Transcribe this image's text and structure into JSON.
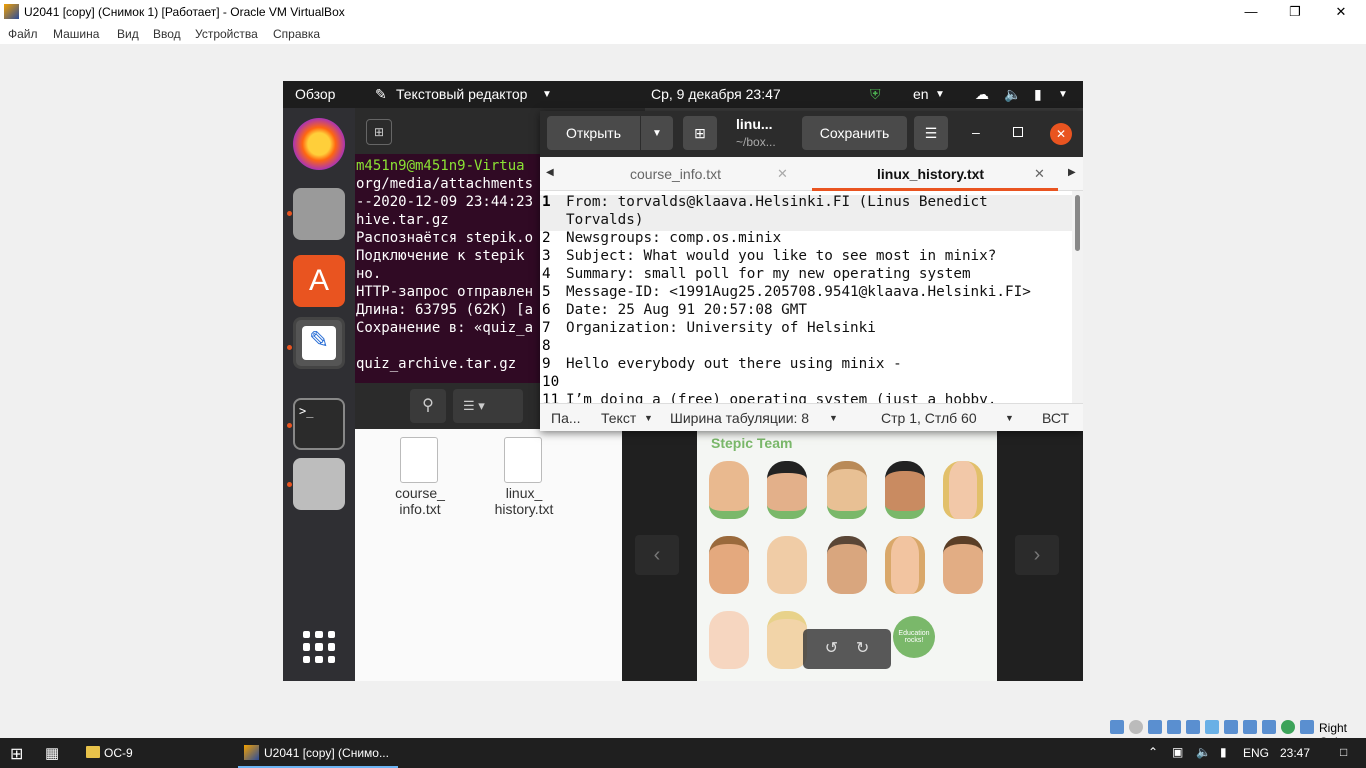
{
  "host": {
    "window_title": "U2041 [copy] (Снимок 1) [Работает] - Oracle VM VirtualBox",
    "menu": [
      "Файл",
      "Машина",
      "Вид",
      "Ввод",
      "Устройства",
      "Справка"
    ],
    "host_key": "Right Ctrl"
  },
  "guest_topbar": {
    "overview": "Обзор",
    "app_menu": "Текстовый редактор",
    "clock": "Ср, 9 декабря  23:47",
    "lang": "en"
  },
  "terminal": {
    "lines": [
      "m451n9@m451n9-Virtua",
      "org/media/attachments",
      "--2020-12-09 23:44:23",
      "hive.tar.gz",
      "Распознаётся stepik.o",
      "Подключение к stepik",
      "но.",
      "HTTP-запрос отправлен",
      "Длина: 63795 (62K) [a",
      "Сохранение в: «quiz_a",
      "",
      "quiz_archive.tar.gz  "
    ]
  },
  "files": {
    "items": [
      {
        "name": "course_\ninfo.txt"
      },
      {
        "name": "linux_\nhistory.txt"
      }
    ]
  },
  "viewer": {
    "photo_title": "Stepic Team",
    "badge": "Education rocks!"
  },
  "editor": {
    "open_label": "Открыть",
    "save_label": "Сохранить",
    "file_title": "linu...",
    "file_path": "~/box...",
    "tabs": [
      {
        "label": "course_info.txt",
        "active": false
      },
      {
        "label": "linux_history.txt",
        "active": true
      }
    ],
    "lines": [
      {
        "n": "1",
        "text": "From: torvalds@klaava.Helsinki.FI (Linus Benedict"
      },
      {
        "n": "",
        "text": "Torvalds)"
      },
      {
        "n": "2",
        "text": "Newsgroups: comp.os.minix"
      },
      {
        "n": "3",
        "text": "Subject: What would you like to see most in minix?"
      },
      {
        "n": "4",
        "text": "Summary: small poll for my new operating system"
      },
      {
        "n": "5",
        "text": "Message-ID: <1991Aug25.205708.9541@klaava.Helsinki.FI>"
      },
      {
        "n": "6",
        "text": "Date: 25 Aug 91 20:57:08 GMT"
      },
      {
        "n": "7",
        "text": "Organization: University of Helsinki"
      },
      {
        "n": "8",
        "text": ""
      },
      {
        "n": "9",
        "text": "Hello everybody out there using minix -"
      },
      {
        "n": "10",
        "text": ""
      },
      {
        "n": "11",
        "text": "I’m doing a (free) operating system (just a hobby,"
      }
    ],
    "status": {
      "pane": "Па...",
      "syntax": "Текст",
      "tab_width": "Ширина табуляции: 8",
      "position": "Стр 1, Стлб 60",
      "mode": "ВСТ"
    }
  },
  "taskbar": {
    "item1": "OC-9",
    "item2": "U2041 [copy] (Снимо...",
    "lang": "ENG",
    "time": "23:47"
  }
}
